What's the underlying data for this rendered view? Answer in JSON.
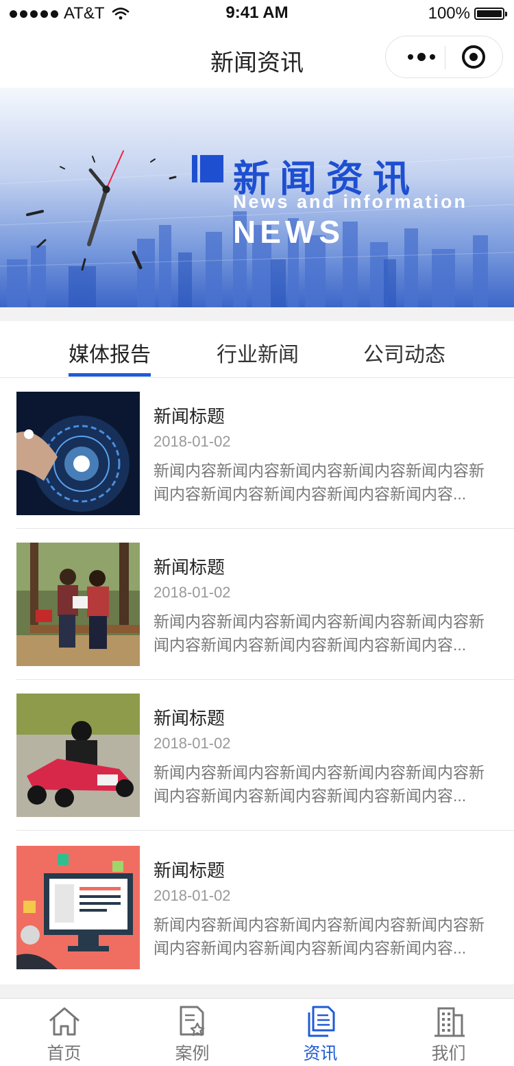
{
  "status_bar": {
    "carrier": "AT&T",
    "time": "9:41 AM",
    "battery_level": "100%"
  },
  "nav": {
    "title": "新闻资讯",
    "more_icon": "more-dots-icon",
    "close_icon": "target-close-icon"
  },
  "banner": {
    "title_cn": "新闻资讯",
    "title_en": "News and information",
    "title_news": "NEWS",
    "accent_color": "#1e4fd0"
  },
  "tabs": [
    {
      "label": "媒体报告",
      "active": true
    },
    {
      "label": "行业新闻",
      "active": false
    },
    {
      "label": "公司动态",
      "active": false
    }
  ],
  "news": [
    {
      "title": "新闻标题",
      "date": "2018-01-02",
      "desc": "新闻内容新闻内容新闻内容新闻内容新闻内容新闻内容新闻内容新闻内容新闻内容新闻内容...",
      "image": "tech-hand-image"
    },
    {
      "title": "新闻标题",
      "date": "2018-01-02",
      "desc": "新闻内容新闻内容新闻内容新闻内容新闻内容新闻内容新闻内容新闻内容新闻内容新闻内容...",
      "image": "students-bench-image"
    },
    {
      "title": "新闻标题",
      "date": "2018-01-02",
      "desc": "新闻内容新闻内容新闻内容新闻内容新闻内容新闻内容新闻内容新闻内容新闻内容新闻内容...",
      "image": "go-kart-image"
    },
    {
      "title": "新闻标题",
      "date": "2018-01-02",
      "desc": "新闻内容新闻内容新闻内容新闻内容新闻内容新闻内容新闻内容新闻内容新闻内容新闻内容...",
      "image": "computer-illustration-image"
    }
  ],
  "tab_bar": [
    {
      "label": "首页",
      "icon": "home-icon",
      "active": false
    },
    {
      "label": "案例",
      "icon": "case-doc-icon",
      "active": false
    },
    {
      "label": "资讯",
      "icon": "news-doc-icon",
      "active": true
    },
    {
      "label": "我们",
      "icon": "building-icon",
      "active": false
    }
  ],
  "colors": {
    "accent": "#1e5bd6",
    "text": "#333333",
    "muted": "#999999"
  }
}
